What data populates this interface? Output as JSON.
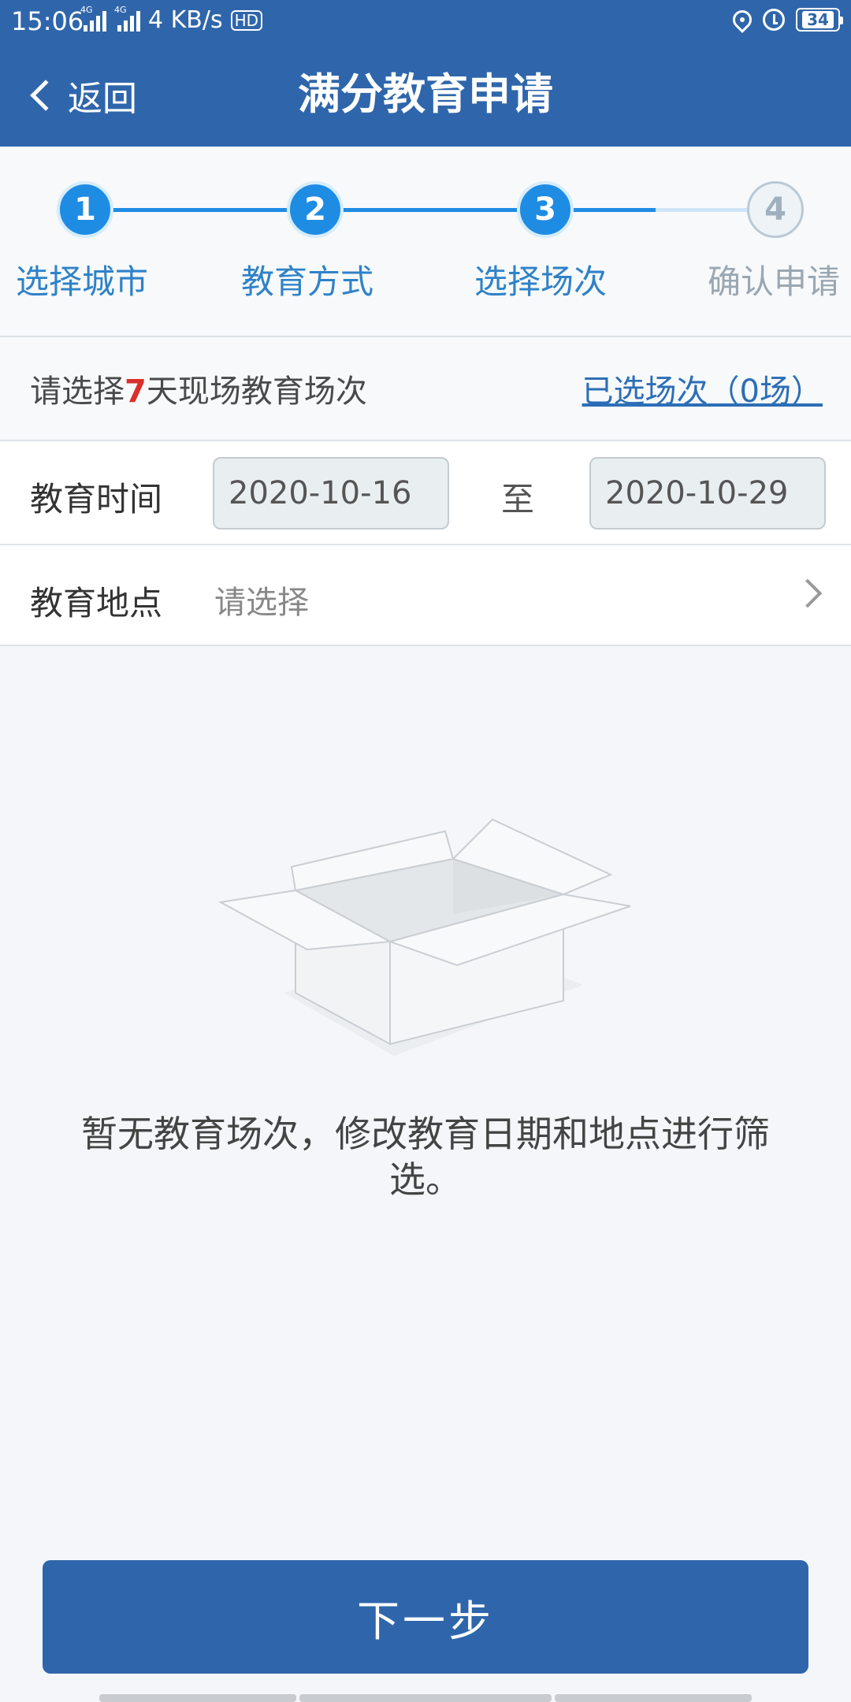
{
  "status_bar": {
    "time": "15:06",
    "signal_1_tag": "4G",
    "signal_2_tag": "4G",
    "speed": "4 KB/s",
    "hd_label": "HD",
    "battery": "34"
  },
  "nav": {
    "back_label": "返回",
    "title": "满分教育申请"
  },
  "steps": [
    {
      "number": "1",
      "label": "选择城市",
      "state": "done"
    },
    {
      "number": "2",
      "label": "教育方式",
      "state": "done"
    },
    {
      "number": "3",
      "label": "选择场次",
      "state": "current"
    },
    {
      "number": "4",
      "label": "确认申请",
      "state": "todo"
    }
  ],
  "selection": {
    "prefix": "请选择",
    "days": "7",
    "suffix": "天现场教育场次",
    "selected_link": "已选场次（0场）"
  },
  "time_row": {
    "label": "教育时间",
    "start_date": "2020-10-16",
    "to_label": "至",
    "end_date": "2020-10-29"
  },
  "place_row": {
    "label": "教育地点",
    "placeholder": "请选择"
  },
  "empty_state": {
    "icon": "empty-box-icon",
    "message": "暂无教育场次，修改教育日期和地点进行筛选。"
  },
  "next_button": {
    "label": "下一步"
  },
  "colors": {
    "primary": "#2f66ab",
    "step_active": "#1f8ce4",
    "highlight": "#d9302b",
    "link": "#2c6eb6"
  }
}
